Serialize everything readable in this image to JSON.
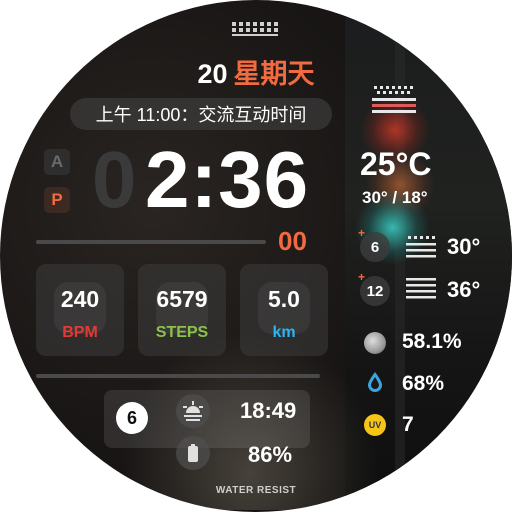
{
  "date": {
    "day": "20",
    "weekday": "星期天"
  },
  "event": {
    "text": "上午 11:00：交流互动时间"
  },
  "clock": {
    "am_label": "A",
    "pm_label": "P",
    "hour_lead": "0",
    "time": "2:36",
    "seconds": "00"
  },
  "stats": [
    {
      "value": "240",
      "label": "BPM",
      "color": "#e53935"
    },
    {
      "value": "6579",
      "label": "STEPS",
      "color": "#8bc34a"
    },
    {
      "value": "5.0",
      "label": "km",
      "color": "#29b6f6"
    }
  ],
  "notifications": {
    "count": "6"
  },
  "sunset": {
    "time": "18:49",
    "icon": "sunset-icon"
  },
  "battery": {
    "level": "86%",
    "icon": "battery-icon"
  },
  "footer": {
    "label": "WATER RESIST"
  },
  "weather": {
    "temp": "25°C",
    "hilo": "30° / 18°",
    "forecast": [
      {
        "plus": "+",
        "hours": "6",
        "temp": "30°",
        "icon": "haze-icon"
      },
      {
        "plus": "+",
        "hours": "12",
        "temp": "36°",
        "icon": "haze-icon"
      }
    ],
    "moon": "58.1%",
    "humidity": "68%",
    "uv_label": "UV",
    "uv": "7"
  },
  "colors": {
    "accent": "#f26a3f",
    "panel": "#3c3c3c"
  }
}
